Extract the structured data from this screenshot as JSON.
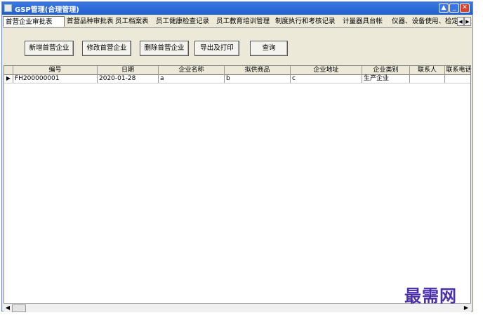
{
  "window": {
    "title": "GSP管理(合理管理)"
  },
  "tabs": [
    "首营企业审批表",
    "首营品种审批表",
    "员工档案表",
    "员工健康检查记录",
    "员工教育培训管理",
    "制度执行和考核记录",
    "计量器具台帐",
    "仪器、设备使用、检定记录"
  ],
  "toolbar": {
    "add": "新增首营企业",
    "edit": "修改首营企业",
    "delete": "删除首营企业",
    "export": "导出及打印",
    "query": "查询"
  },
  "table": {
    "columns": [
      "编号",
      "日期",
      "企业名称",
      "拟供商品",
      "企业地址",
      "企业类别",
      "联系人",
      "联系电话"
    ],
    "rows": [
      [
        "FH200000001",
        "2020-01-28",
        "a",
        "b",
        "c",
        "生产企业",
        "",
        ""
      ]
    ]
  },
  "watermark": "最需网"
}
